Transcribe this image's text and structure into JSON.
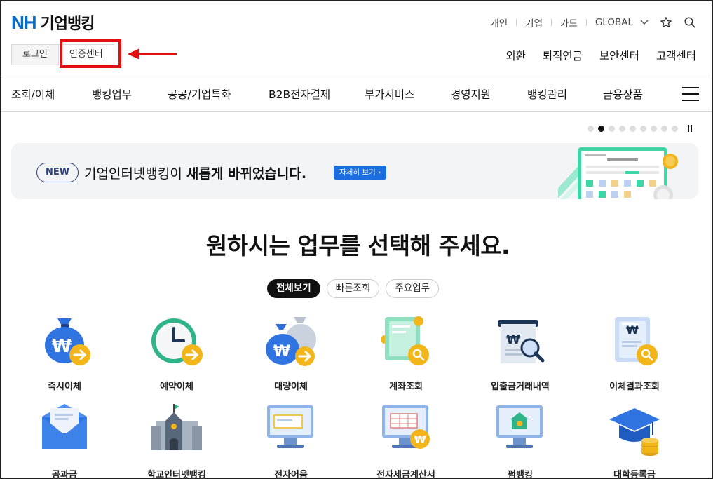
{
  "header": {
    "logo_nh": "NH",
    "logo_text": "기업뱅킹",
    "util_links": [
      "개인",
      "기업",
      "카드",
      "GLOBAL"
    ],
    "login_label": "로그인",
    "cert_label": "인증센터",
    "sub_nav": [
      "외환",
      "퇴직연금",
      "보안센터",
      "고객센터"
    ]
  },
  "gnb": [
    "조회/이체",
    "뱅킹업무",
    "공공/기업특화",
    "B2B전자결제",
    "부가서비스",
    "경영지원",
    "뱅킹관리",
    "금융상품"
  ],
  "banner": {
    "badge": "NEW",
    "text_normal": "기업인터넷뱅킹이 ",
    "text_bold": "새롭게 바뀌었습니다.",
    "more_label": "자세히 보기 ›",
    "slide_count": 9,
    "active_slide": 2
  },
  "main": {
    "headline": "원하시는 업무를 선택해 주세요.",
    "tabs": [
      "전체보기",
      "빠른조회",
      "주요업무"
    ],
    "services": [
      {
        "label": "즉시이체",
        "icon": "money-bag-arrow-icon"
      },
      {
        "label": "예약이체",
        "icon": "clock-arrow-icon"
      },
      {
        "label": "대량이체",
        "icon": "multi-money-bag-icon"
      },
      {
        "label": "계좌조회",
        "icon": "account-search-icon"
      },
      {
        "label": "입출금거래내역",
        "icon": "receipt-search-icon"
      },
      {
        "label": "이체결과조회",
        "icon": "document-search-icon"
      },
      {
        "label": "공과금",
        "icon": "envelope-icon"
      },
      {
        "label": "학교인터넷뱅킹",
        "icon": "school-building-icon"
      },
      {
        "label": "전자어음",
        "icon": "monitor-bill-icon"
      },
      {
        "label": "전자세금계산서",
        "icon": "monitor-tax-icon"
      },
      {
        "label": "펌뱅킹",
        "icon": "monitor-bank-icon"
      },
      {
        "label": "대학등록금",
        "icon": "graduation-cap-icon"
      }
    ]
  },
  "colors": {
    "brand_blue": "#0a6cc8",
    "highlight_red": "#e20f0f",
    "button_blue": "#1b6de0",
    "coin_yellow": "#f2b61a"
  }
}
